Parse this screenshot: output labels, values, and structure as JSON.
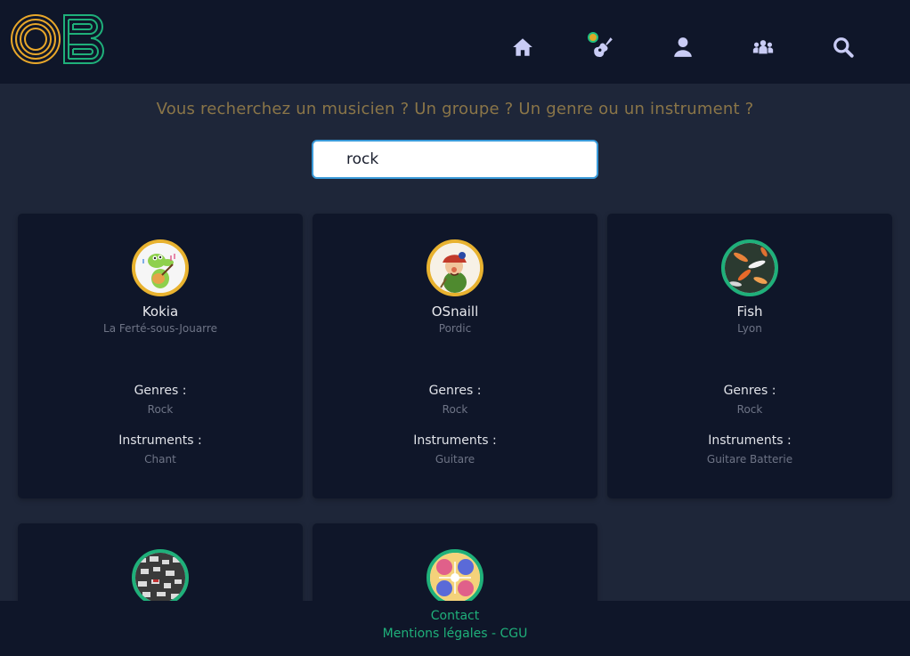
{
  "search": {
    "tagline": "Vous recherchez un musicien ? Un groupe ? Un genre ou un instrument ?",
    "query": "rock"
  },
  "nav": {
    "icons": [
      "home-icon",
      "guitar-icon",
      "user-icon",
      "group-icon",
      "search-icon"
    ]
  },
  "results": [
    {
      "name": "Kokia",
      "city": "La Ferté-sous-Jouarre",
      "genres_label": "Genres :",
      "genres": "Rock",
      "instruments_label": "Instruments :",
      "instruments": "Chant"
    },
    {
      "name": "OSnaill",
      "city": "Pordic",
      "genres_label": "Genres :",
      "genres": "Rock",
      "instruments_label": "Instruments :",
      "instruments": "Guitare"
    },
    {
      "name": "Fish",
      "city": "Lyon",
      "genres_label": "Genres :",
      "genres": "Rock",
      "instruments_label": "Instruments :",
      "instruments": "Guitare Batterie"
    }
  ],
  "footer": {
    "contact": "Contact",
    "legal": "Mentions légales - CGU"
  },
  "colors": {
    "header_bg": "#0f1629",
    "page_bg": "#1e2639",
    "accent_green": "#1fb07a",
    "accent_yellow": "#e8b22f",
    "nav_icon": "#c9ccf5"
  }
}
